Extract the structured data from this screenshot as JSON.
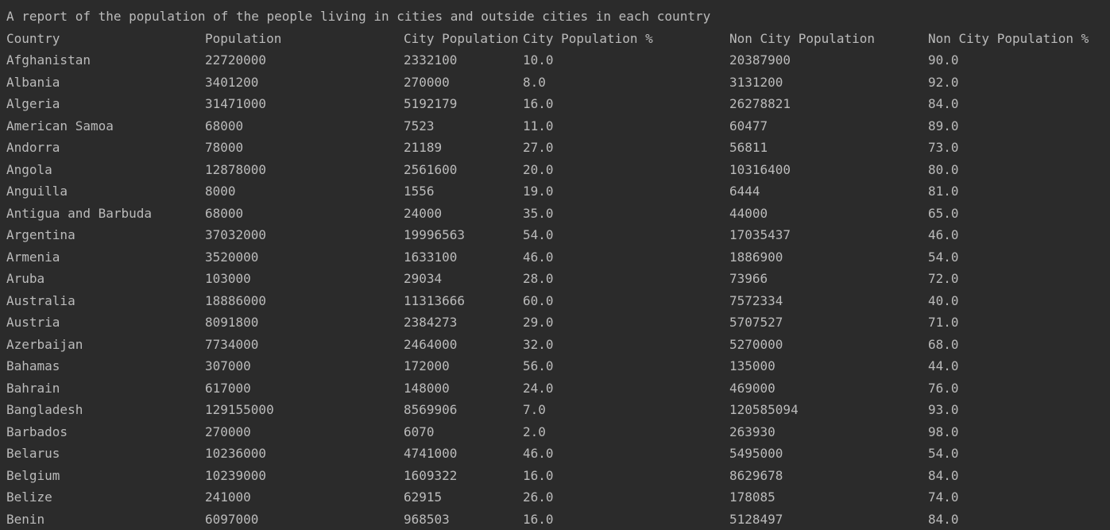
{
  "console": {
    "report_title": "A report of the population of the people living in cities and outside cities in each country",
    "columns": [
      "Country",
      "Population",
      "City Population",
      "City Population %",
      "Non City Population",
      "Non City Population %"
    ],
    "rows": [
      [
        "Afghanistan",
        "22720000",
        "2332100",
        "10.0",
        "20387900",
        "90.0"
      ],
      [
        "Albania",
        "3401200",
        "270000",
        "8.0",
        "3131200",
        "92.0"
      ],
      [
        "Algeria",
        "31471000",
        "5192179",
        "16.0",
        "26278821",
        "84.0"
      ],
      [
        "American Samoa",
        "68000",
        "7523",
        "11.0",
        "60477",
        "89.0"
      ],
      [
        "Andorra",
        "78000",
        "21189",
        "27.0",
        "56811",
        "73.0"
      ],
      [
        "Angola",
        "12878000",
        "2561600",
        "20.0",
        "10316400",
        "80.0"
      ],
      [
        "Anguilla",
        "8000",
        "1556",
        "19.0",
        "6444",
        "81.0"
      ],
      [
        "Antigua and Barbuda",
        "68000",
        "24000",
        "35.0",
        "44000",
        "65.0"
      ],
      [
        "Argentina",
        "37032000",
        "19996563",
        "54.0",
        "17035437",
        "46.0"
      ],
      [
        "Armenia",
        "3520000",
        "1633100",
        "46.0",
        "1886900",
        "54.0"
      ],
      [
        "Aruba",
        "103000",
        "29034",
        "28.0",
        "73966",
        "72.0"
      ],
      [
        "Australia",
        "18886000",
        "11313666",
        "60.0",
        "7572334",
        "40.0"
      ],
      [
        "Austria",
        "8091800",
        "2384273",
        "29.0",
        "5707527",
        "71.0"
      ],
      [
        "Azerbaijan",
        "7734000",
        "2464000",
        "32.0",
        "5270000",
        "68.0"
      ],
      [
        "Bahamas",
        "307000",
        "172000",
        "56.0",
        "135000",
        "44.0"
      ],
      [
        "Bahrain",
        "617000",
        "148000",
        "24.0",
        "469000",
        "76.0"
      ],
      [
        "Bangladesh",
        "129155000",
        "8569906",
        "7.0",
        "120585094",
        "93.0"
      ],
      [
        "Barbados",
        "270000",
        "6070",
        "2.0",
        "263930",
        "98.0"
      ],
      [
        "Belarus",
        "10236000",
        "4741000",
        "46.0",
        "5495000",
        "54.0"
      ],
      [
        "Belgium",
        "10239000",
        "1609322",
        "16.0",
        "8629678",
        "84.0"
      ],
      [
        "Belize",
        "241000",
        "62915",
        "26.0",
        "178085",
        "74.0"
      ],
      [
        "Benin",
        "6097000",
        "968503",
        "16.0",
        "5128497",
        "84.0"
      ]
    ]
  }
}
